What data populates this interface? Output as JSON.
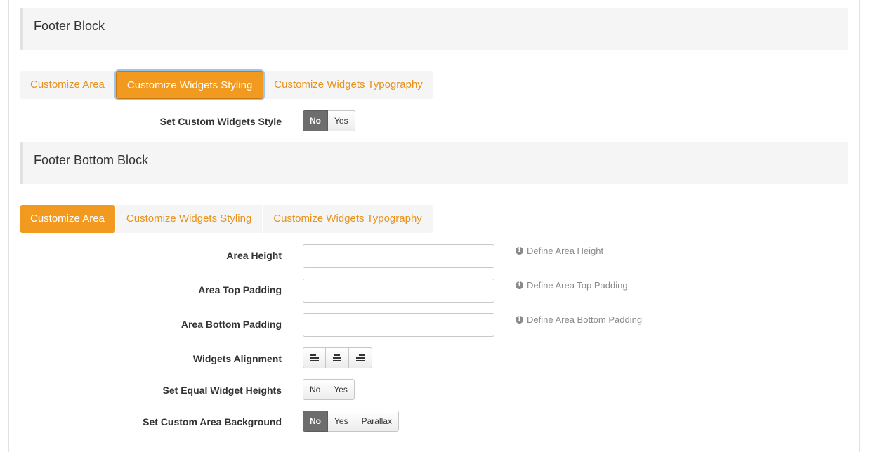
{
  "footer_block": {
    "title": "Footer Block",
    "tabs": [
      {
        "label": "Customize Area",
        "active": false
      },
      {
        "label": "Customize Widgets Styling",
        "active": true
      },
      {
        "label": "Customize Widgets Typography",
        "active": false
      }
    ],
    "set_custom_widgets_style": {
      "label": "Set Custom Widgets Style",
      "options": [
        "No",
        "Yes"
      ],
      "selected": "No"
    }
  },
  "footer_bottom_block": {
    "title": "Footer Bottom Block",
    "tabs": [
      {
        "label": "Customize Area",
        "active": true
      },
      {
        "label": "Customize Widgets Styling",
        "active": false
      },
      {
        "label": "Customize Widgets Typography",
        "active": false
      }
    ],
    "area_height": {
      "label": "Area Height",
      "value": "",
      "hint": "Define Area Height"
    },
    "area_top_padding": {
      "label": "Area Top Padding",
      "value": "",
      "hint": "Define Area Top Padding"
    },
    "area_bottom_padding": {
      "label": "Area Bottom Padding",
      "value": "",
      "hint": "Define Area Bottom Padding"
    },
    "widgets_alignment": {
      "label": "Widgets Alignment",
      "options": [
        "align-left-icon",
        "align-center-icon",
        "align-right-icon"
      ]
    },
    "set_equal_widget_heights": {
      "label": "Set Equal Widget Heights",
      "options": [
        "No",
        "Yes"
      ],
      "selected": null
    },
    "set_custom_area_background": {
      "label": "Set Custom Area Background",
      "options": [
        "No",
        "Yes",
        "Parallax"
      ],
      "selected": "No"
    }
  },
  "colors": {
    "accent": "#f29a1f",
    "tab_text": "#e8921a",
    "active_toggle": "#6d6d6d",
    "section_bg": "#f5f5f5"
  }
}
